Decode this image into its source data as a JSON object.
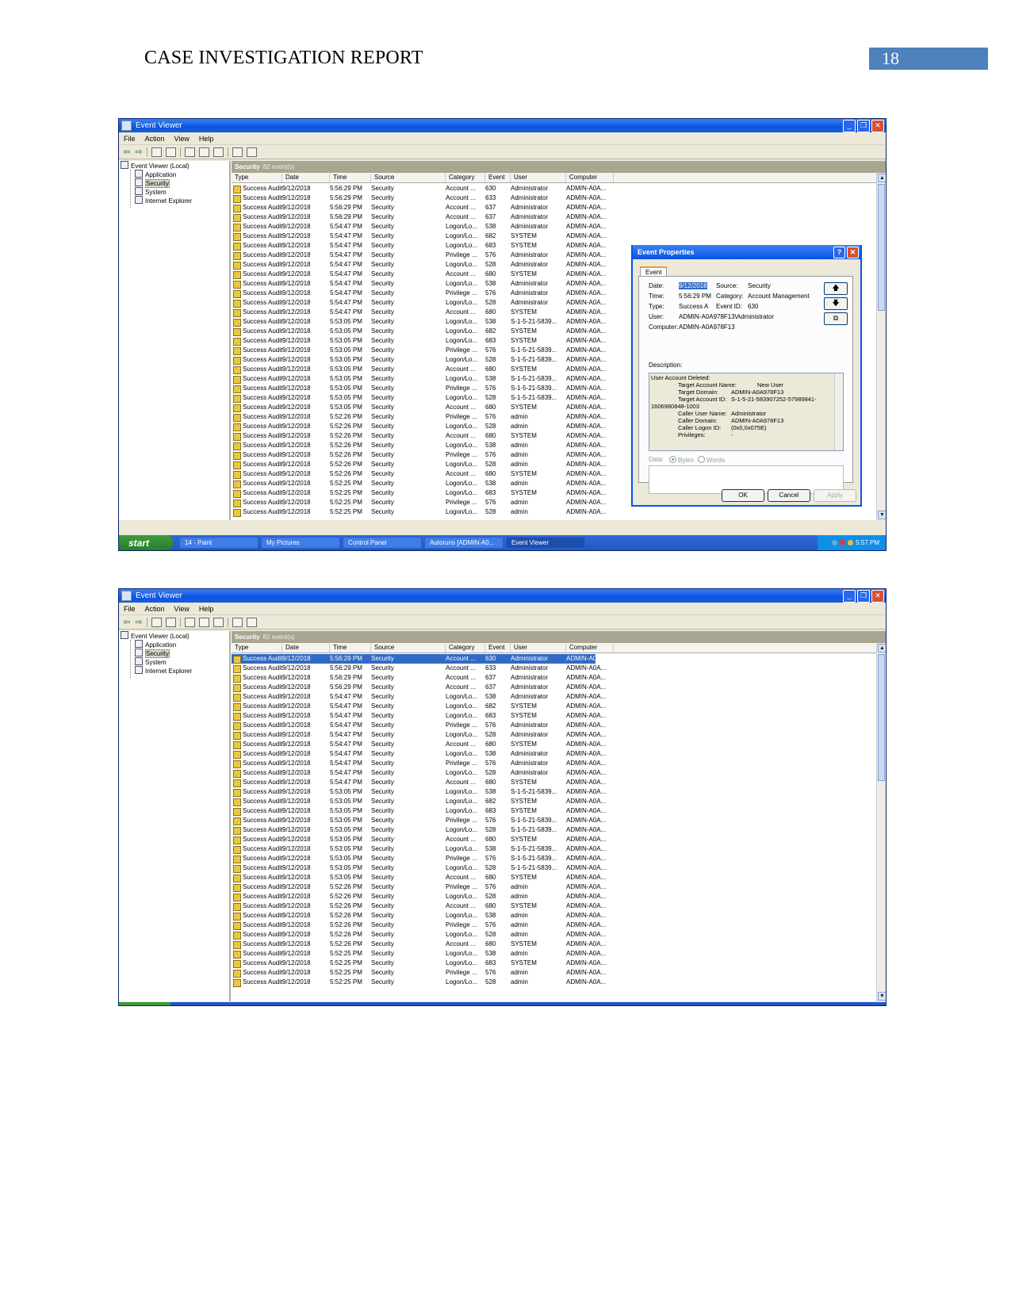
{
  "page": {
    "header_title": "CASE INVESTIGATION REPORT",
    "page_number": "18"
  },
  "window": {
    "title": "Event Viewer",
    "menu": [
      "File",
      "Action",
      "View",
      "Help"
    ],
    "tree": {
      "root": "Event Viewer (Local)",
      "children": [
        "Application",
        "Security",
        "System",
        "Internet Explorer"
      ]
    },
    "list_title": "Security",
    "list_count": "82 event(s)",
    "columns": [
      "Type",
      "Date",
      "Time",
      "Source",
      "Category",
      "Event",
      "User",
      "Computer"
    ]
  },
  "events": [
    [
      "Success Audit",
      "9/12/2018",
      "5:56:29 PM",
      "Security",
      "Account ...",
      "630",
      "Administrator",
      "ADMIN-A0A..."
    ],
    [
      "Success Audit",
      "9/12/2018",
      "5:56:29 PM",
      "Security",
      "Account ...",
      "633",
      "Administrator",
      "ADMIN-A0A..."
    ],
    [
      "Success Audit",
      "9/12/2018",
      "5:56:29 PM",
      "Security",
      "Account ...",
      "637",
      "Administrator",
      "ADMIN-A0A..."
    ],
    [
      "Success Audit",
      "9/12/2018",
      "5:56:29 PM",
      "Security",
      "Account ...",
      "637",
      "Administrator",
      "ADMIN-A0A..."
    ],
    [
      "Success Audit",
      "9/12/2018",
      "5:54:47 PM",
      "Security",
      "Logon/Lo...",
      "538",
      "Administrator",
      "ADMIN-A0A..."
    ],
    [
      "Success Audit",
      "9/12/2018",
      "5:54:47 PM",
      "Security",
      "Logon/Lo...",
      "682",
      "SYSTEM",
      "ADMIN-A0A..."
    ],
    [
      "Success Audit",
      "9/12/2018",
      "5:54:47 PM",
      "Security",
      "Logon/Lo...",
      "683",
      "SYSTEM",
      "ADMIN-A0A..."
    ],
    [
      "Success Audit",
      "9/12/2018",
      "5:54:47 PM",
      "Security",
      "Privilege ...",
      "576",
      "Administrator",
      "ADMIN-A0A..."
    ],
    [
      "Success Audit",
      "9/12/2018",
      "5:54:47 PM",
      "Security",
      "Logon/Lo...",
      "528",
      "Administrator",
      "ADMIN-A0A..."
    ],
    [
      "Success Audit",
      "9/12/2018",
      "5:54:47 PM",
      "Security",
      "Account ...",
      "680",
      "SYSTEM",
      "ADMIN-A0A..."
    ],
    [
      "Success Audit",
      "9/12/2018",
      "5:54:47 PM",
      "Security",
      "Logon/Lo...",
      "538",
      "Administrator",
      "ADMIN-A0A..."
    ],
    [
      "Success Audit",
      "9/12/2018",
      "5:54:47 PM",
      "Security",
      "Privilege ...",
      "576",
      "Administrator",
      "ADMIN-A0A..."
    ],
    [
      "Success Audit",
      "9/12/2018",
      "5:54:47 PM",
      "Security",
      "Logon/Lo...",
      "528",
      "Administrator",
      "ADMIN-A0A..."
    ],
    [
      "Success Audit",
      "9/12/2018",
      "5:54:47 PM",
      "Security",
      "Account ...",
      "680",
      "SYSTEM",
      "ADMIN-A0A..."
    ],
    [
      "Success Audit",
      "9/12/2018",
      "5:53:05 PM",
      "Security",
      "Logon/Lo...",
      "538",
      "S-1-5-21-5839...",
      "ADMIN-A0A..."
    ],
    [
      "Success Audit",
      "9/12/2018",
      "5:53:05 PM",
      "Security",
      "Logon/Lo...",
      "682",
      "SYSTEM",
      "ADMIN-A0A..."
    ],
    [
      "Success Audit",
      "9/12/2018",
      "5:53:05 PM",
      "Security",
      "Logon/Lo...",
      "683",
      "SYSTEM",
      "ADMIN-A0A..."
    ],
    [
      "Success Audit",
      "9/12/2018",
      "5:53:05 PM",
      "Security",
      "Privilege ...",
      "576",
      "S-1-5-21-5839...",
      "ADMIN-A0A..."
    ],
    [
      "Success Audit",
      "9/12/2018",
      "5:53:05 PM",
      "Security",
      "Logon/Lo...",
      "528",
      "S-1-5-21-5839...",
      "ADMIN-A0A..."
    ],
    [
      "Success Audit",
      "9/12/2018",
      "5:53:05 PM",
      "Security",
      "Account ...",
      "680",
      "SYSTEM",
      "ADMIN-A0A..."
    ],
    [
      "Success Audit",
      "9/12/2018",
      "5:53:05 PM",
      "Security",
      "Logon/Lo...",
      "538",
      "S-1-5-21-5839...",
      "ADMIN-A0A..."
    ],
    [
      "Success Audit",
      "9/12/2018",
      "5:53:05 PM",
      "Security",
      "Privilege ...",
      "576",
      "S-1-5-21-5839...",
      "ADMIN-A0A..."
    ],
    [
      "Success Audit",
      "9/12/2018",
      "5:53:05 PM",
      "Security",
      "Logon/Lo...",
      "528",
      "S-1-5-21-5839...",
      "ADMIN-A0A..."
    ],
    [
      "Success Audit",
      "9/12/2018",
      "5:53:05 PM",
      "Security",
      "Account ...",
      "680",
      "SYSTEM",
      "ADMIN-A0A..."
    ],
    [
      "Success Audit",
      "9/12/2018",
      "5:52:26 PM",
      "Security",
      "Privilege ...",
      "576",
      "admin",
      "ADMIN-A0A..."
    ],
    [
      "Success Audit",
      "9/12/2018",
      "5:52:26 PM",
      "Security",
      "Logon/Lo...",
      "528",
      "admin",
      "ADMIN-A0A..."
    ],
    [
      "Success Audit",
      "9/12/2018",
      "5:52:26 PM",
      "Security",
      "Account ...",
      "680",
      "SYSTEM",
      "ADMIN-A0A..."
    ],
    [
      "Success Audit",
      "9/12/2018",
      "5:52:26 PM",
      "Security",
      "Logon/Lo...",
      "538",
      "admin",
      "ADMIN-A0A..."
    ],
    [
      "Success Audit",
      "9/12/2018",
      "5:52:26 PM",
      "Security",
      "Privilege ...",
      "576",
      "admin",
      "ADMIN-A0A..."
    ],
    [
      "Success Audit",
      "9/12/2018",
      "5:52:26 PM",
      "Security",
      "Logon/Lo...",
      "528",
      "admin",
      "ADMIN-A0A..."
    ],
    [
      "Success Audit",
      "9/12/2018",
      "5:52:26 PM",
      "Security",
      "Account ...",
      "680",
      "SYSTEM",
      "ADMIN-A0A..."
    ],
    [
      "Success Audit",
      "9/12/2018",
      "5:52:25 PM",
      "Security",
      "Logon/Lo...",
      "538",
      "admin",
      "ADMIN-A0A..."
    ],
    [
      "Success Audit",
      "9/12/2018",
      "5:52:25 PM",
      "Security",
      "Logon/Lo...",
      "683",
      "SYSTEM",
      "ADMIN-A0A..."
    ],
    [
      "Success Audit",
      "9/12/2018",
      "5:52:25 PM",
      "Security",
      "Privilege ...",
      "576",
      "admin",
      "ADMIN-A0A..."
    ],
    [
      "Success Audit",
      "9/12/2018",
      "5:52:25 PM",
      "Security",
      "Logon/Lo...",
      "528",
      "admin",
      "ADMIN-A0A..."
    ]
  ],
  "taskbar": {
    "start": "start",
    "tasks": [
      "14 - Paint",
      "My Pictures",
      "Control Panel",
      "Autoruns [ADMIN-A0...",
      "Event Viewer"
    ],
    "clock": "5:57 PM"
  },
  "dialog": {
    "title": "Event Properties",
    "tab": "Event",
    "date_label": "Date:",
    "date": "9/12/2018",
    "source_label": "Source:",
    "source": "Security",
    "time_label": "Time:",
    "time": "5:56:29 PM",
    "category_label": "Category:",
    "category": "Account Management",
    "type_label": "Type:",
    "type": "Success A",
    "eventid_label": "Event ID:",
    "eventid": "630",
    "user_label": "User:",
    "user": "ADMIN-A0A978F13\\Administrator",
    "computer_label": "Computer:",
    "computer": "ADMIN-A0A978F13",
    "description_label": "Description:",
    "description_lines": [
      "User Account Deleted:",
      "Target Account Name:",
      "New User",
      "Target Domain:",
      "ADMIN-A0A978F13",
      "Target Account ID:",
      "S-1-5-21-583907252-57989841-",
      "1606980848-1003",
      "Caller User Name:",
      "Administrator",
      "Caller Domain:",
      "ADMIN-A0A978F13",
      "Caller Logon ID:",
      "(0x0,0x075E)",
      "Privileges:",
      "-"
    ],
    "data_label": "Data:",
    "bytes_label": "Bytes",
    "words_label": "Words",
    "ok": "OK",
    "cancel": "Cancel",
    "apply": "Apply"
  }
}
